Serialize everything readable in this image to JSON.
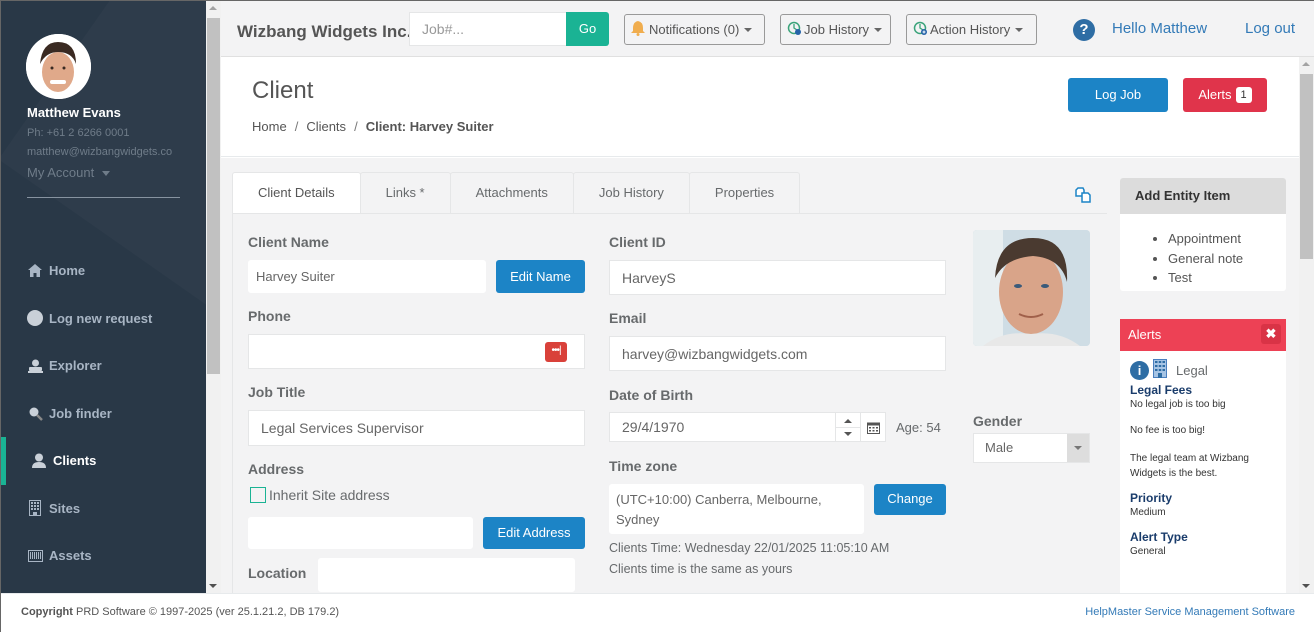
{
  "user": {
    "name": "Matthew Evans",
    "phone": "Ph: +61 2 6266 0001",
    "email": "matthew@wizbangwidgets.co",
    "account_label": "My Account"
  },
  "nav": [
    {
      "label": "Home",
      "icon": "home-icon"
    },
    {
      "label": "Log new request",
      "icon": "circle-icon"
    },
    {
      "label": "Explorer",
      "icon": "explorer-icon"
    },
    {
      "label": "Job finder",
      "icon": "search-icon"
    },
    {
      "label": "Clients",
      "icon": "user-icon",
      "active": true
    },
    {
      "label": "Sites",
      "icon": "building-icon"
    },
    {
      "label": "Assets",
      "icon": "barcode-icon"
    }
  ],
  "topbar": {
    "brand": "Wizbang Widgets Inc.",
    "job_placeholder": "Job#...",
    "go_label": "Go",
    "notifications_label": "Notifications (0)",
    "job_history_label": "Job History",
    "action_history_label": "Action History",
    "hello": "Hello Matthew",
    "logout": "Log out"
  },
  "header": {
    "title": "Client",
    "breadcrumb": [
      "Home",
      "Clients",
      "Client: Harvey Suiter"
    ],
    "log_job_label": "Log Job",
    "alerts_label": "Alerts",
    "alerts_count": "1"
  },
  "tabs": [
    "Client Details",
    "Links *",
    "Attachments",
    "Job History",
    "Properties"
  ],
  "form": {
    "client_name_label": "Client Name",
    "client_name": "Harvey Suiter",
    "edit_name_label": "Edit Name",
    "phone_label": "Phone",
    "phone": "",
    "job_title_label": "Job Title",
    "job_title": "Legal Services Supervisor",
    "address_label": "Address",
    "inherit_label": "Inherit Site address",
    "edit_address_label": "Edit Address",
    "location_label": "Location",
    "client_id_label": "Client ID",
    "client_id": "HarveyS",
    "email_label": "Email",
    "email": "harvey@wizbangwidgets.com",
    "dob_label": "Date of Birth",
    "dob": "29/4/1970",
    "age": "Age: 54",
    "timezone_label": "Time zone",
    "timezone": "(UTC+10:00) Canberra, Melbourne, Sydney",
    "change_label": "Change",
    "clients_time": "Clients Time: Wednesday 22/01/2025 11:05:10 AM",
    "time_same": "Clients time is the same as yours",
    "gender_label": "Gender",
    "gender": "Male"
  },
  "entity": {
    "title": "Add Entity Item",
    "items": [
      "Appointment",
      "General note",
      "Test"
    ]
  },
  "alerts_panel": {
    "title": "Alerts",
    "category": "Legal",
    "heading": "Legal Fees",
    "lines": [
      "No legal job is too big",
      "No fee is too big!",
      "The legal team at Wizbang Widgets is the best."
    ],
    "priority_label": "Priority",
    "priority": "Medium",
    "type_label": "Alert Type",
    "type": "General"
  },
  "footer": {
    "copyright_bold": "Copyright",
    "copyright": "PRD Software © 1997-2025 (ver 25.1.21.2, DB 179.2)",
    "product": "HelpMaster Service Management Software"
  }
}
